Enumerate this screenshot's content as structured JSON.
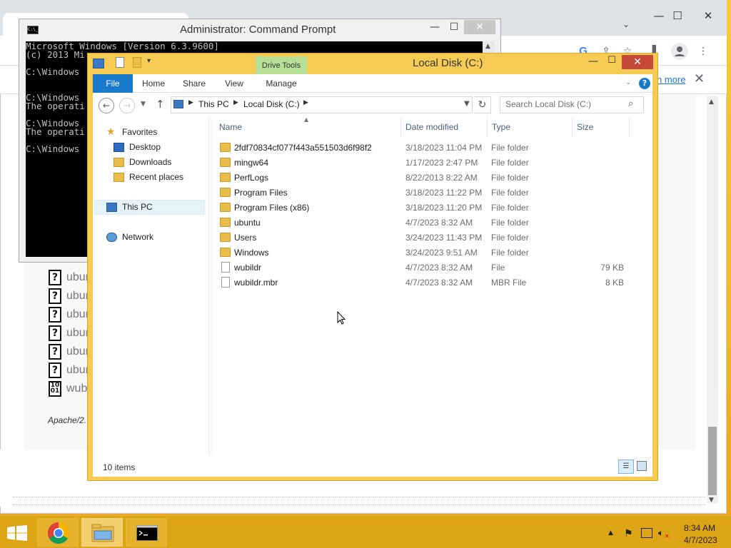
{
  "colors": {
    "desktop": "#f2b72a",
    "taskbar": "#dda416",
    "explorer_frame": "#f5cb54",
    "ribbon_file_tab": "#1979ca",
    "drive_tools": "#b6e098",
    "close_button": "#c7493a"
  },
  "chrome": {
    "tab_search_icon": "chevron-down-icon",
    "toolbar_icons": [
      "google-icon",
      "share-icon",
      "star-icon",
      "side-panel-icon",
      "profile-icon",
      "menu-icon"
    ],
    "infobar_link": "n more",
    "infobar_close": "✕",
    "page_files": [
      {
        "icon": "unknown-file-icon",
        "name": "ubun"
      },
      {
        "icon": "unknown-file-icon",
        "name": "ubun"
      },
      {
        "icon": "unknown-file-icon",
        "name": "ubun"
      },
      {
        "icon": "unknown-file-icon",
        "name": "ubun"
      },
      {
        "icon": "unknown-file-icon",
        "name": "ubun"
      },
      {
        "icon": "unknown-file-icon",
        "name": "ubun"
      },
      {
        "icon": "binary-file-icon",
        "name": "wub"
      }
    ],
    "footer_text": "Apache/2.",
    "min_glyph": "—",
    "max_glyph": "☐",
    "close_glyph": "✕"
  },
  "cmd": {
    "title": "Administrator:  Command Prompt",
    "icon_text": "C:\\_",
    "lines": [
      "Microsoft Windows [Version 6.3.9600]",
      "(c) 2013 Mi",
      "",
      "C:\\Windows",
      "",
      "",
      "C:\\Windows",
      "The operati",
      "",
      "C:\\Windows",
      "The operati",
      "",
      "C:\\Windows"
    ],
    "min_glyph": "—",
    "max_glyph": "☐",
    "close_glyph": "✕"
  },
  "explorer": {
    "title": "Local Disk (C:)",
    "context_tab_group": "Drive Tools",
    "ribbon_tabs": [
      "File",
      "Home",
      "Share",
      "View",
      "Manage"
    ],
    "breadcrumbs": [
      "This PC",
      "Local Disk (C:)"
    ],
    "search_placeholder": "Search Local Disk (C:)",
    "nav_pane": {
      "favorites": "Favorites",
      "desktop": "Desktop",
      "downloads": "Downloads",
      "recent_places": "Recent places",
      "this_pc": "This PC",
      "network": "Network"
    },
    "columns": {
      "name": "Name",
      "date_modified": "Date modified",
      "type": "Type",
      "size": "Size"
    },
    "files": [
      {
        "name": "2fdf70834cf077f443a551503d6f98f2",
        "date": "3/18/2023 11:04 PM",
        "type": "File folder",
        "size": "",
        "icon": "folder-icon"
      },
      {
        "name": "mingw64",
        "date": "1/17/2023 2:47 PM",
        "type": "File folder",
        "size": "",
        "icon": "folder-icon"
      },
      {
        "name": "PerfLogs",
        "date": "8/22/2013 8:22 AM",
        "type": "File folder",
        "size": "",
        "icon": "folder-icon"
      },
      {
        "name": "Program Files",
        "date": "3/18/2023 11:22 PM",
        "type": "File folder",
        "size": "",
        "icon": "folder-icon"
      },
      {
        "name": "Program Files (x86)",
        "date": "3/18/2023 11:20 PM",
        "type": "File folder",
        "size": "",
        "icon": "folder-icon"
      },
      {
        "name": "ubuntu",
        "date": "4/7/2023 8:32 AM",
        "type": "File folder",
        "size": "",
        "icon": "folder-icon"
      },
      {
        "name": "Users",
        "date": "3/24/2023 11:43 PM",
        "type": "File folder",
        "size": "",
        "icon": "folder-icon"
      },
      {
        "name": "Windows",
        "date": "3/24/2023 9:51 AM",
        "type": "File folder",
        "size": "",
        "icon": "folder-icon"
      },
      {
        "name": "wubildr",
        "date": "4/7/2023 8:32 AM",
        "type": "File",
        "size": "79 KB",
        "icon": "file-icon"
      },
      {
        "name": "wubildr.mbr",
        "date": "4/7/2023 8:32 AM",
        "type": "MBR File",
        "size": "8 KB",
        "icon": "file-icon"
      }
    ],
    "status_count": "10 items",
    "min_glyph": "—",
    "max_glyph": "☐",
    "close_glyph": "✕",
    "help_glyph": "?"
  },
  "taskbar": {
    "apps": [
      "chrome-icon",
      "file-explorer-icon",
      "command-prompt-icon"
    ],
    "tray_icons": [
      "show-hidden-icons-icon",
      "action-center-flag-icon",
      "network-icon",
      "volume-muted-icon"
    ],
    "time": "8:34 AM",
    "date": "4/7/2023"
  }
}
